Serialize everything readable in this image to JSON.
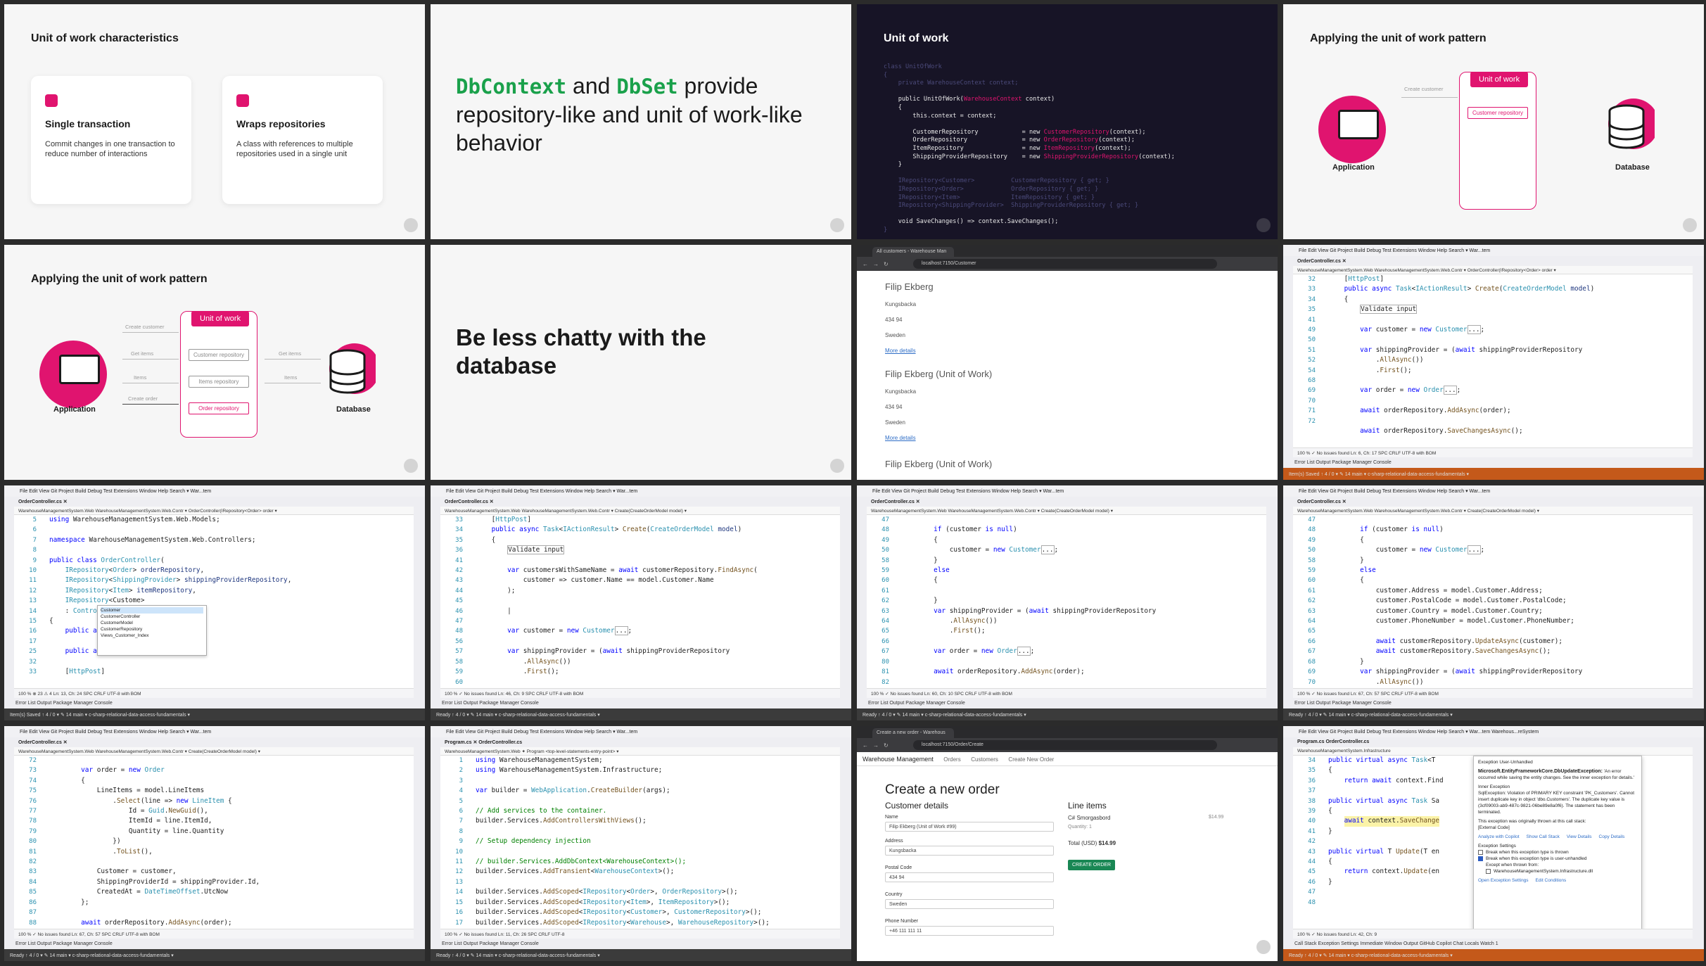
{
  "slides": {
    "characteristics": {
      "title": "Unit of work characteristics",
      "cards": [
        {
          "icon": "database-icon",
          "heading": "Single transaction",
          "text": "Commit changes in one transaction to reduce number of interactions"
        },
        {
          "icon": "layers-icon",
          "heading": "Wraps repositories",
          "text": "A class with references to multiple repositories used in a single unit"
        }
      ]
    },
    "dbcontext": {
      "m1": "DbContext",
      "t1": " and ",
      "m2": "DbSet",
      "t2": " provide repository-like and unit of work-like behavior"
    },
    "unit_of_work_code": {
      "title": "Unit of work",
      "l1": "class UnitOfWork",
      "l2": "{",
      "l3": "    private WarehouseContext context;",
      "l4": "    public UnitOfWork(",
      "l4b": "WarehouseContext",
      "l4c": " context)",
      "l5": "    {",
      "l6": "        this.context = context;",
      "l7a": "        CustomerRepository            = new ",
      "l7b": "CustomerRepository",
      "l7c": "(context);",
      "l8a": "        OrderRepository               = new ",
      "l8b": "OrderRepository",
      "l8c": "(context);",
      "l9a": "        ItemRepository                = new ",
      "l9b": "ItemRepository",
      "l9c": "(context);",
      "l10a": "        ShippingProviderRepository    = new ",
      "l10b": "ShippingProviderRepository",
      "l10c": "(context);",
      "l11": "    }",
      "l12": "    IRepository<Customer>          CustomerRepository { get; }",
      "l13": "    IRepository<Order>             OrderRepository { get; }",
      "l14": "    IRepository<Item>              ItemRepository { get; }",
      "l15": "    IRepository<ShippingProvider>  ShippingProviderRepository { get; }",
      "l16": "    void SaveChanges() => context.SaveChanges();",
      "l17": "}"
    },
    "applying1": {
      "title": "Applying the unit of work pattern",
      "tag": "Unit of work",
      "repo": "Customer repository",
      "arrow": "Create customer",
      "app": "Application",
      "db": "Database"
    },
    "applying2": {
      "title": "Applying the unit of work pattern",
      "tag": "Unit of work",
      "repos": [
        "Customer repository",
        "Items repository",
        "Order repository"
      ],
      "arrows_left": [
        "Create customer",
        "Get items",
        "Items",
        "Create order"
      ],
      "arrows_right": [
        "Get items",
        "Items"
      ],
      "app": "Application",
      "db": "Database"
    },
    "chatty": {
      "title": "Be less chatty with the database"
    }
  },
  "browser1": {
    "tab": "All customers - Warehouse Man",
    "url": "localhost:7150/Customer",
    "customers": [
      {
        "name": "Filip Ekberg",
        "lines": [
          "Kungsbacka",
          "434 94",
          "Sweden"
        ],
        "link": "More details"
      },
      {
        "name": "Filip Ekberg (Unit of Work)",
        "lines": [
          "Kungsbacka",
          "434 94",
          "Sweden"
        ],
        "link": "More details"
      },
      {
        "name": "Filip Ekberg (Unit of Work)"
      }
    ]
  },
  "vs": {
    "menu": "File  Edit  View  Git  Project  Build  Debug  Test  Extensions  Window  Help   Search ▾     War...tem",
    "panes": "Error List   Output   Package Manager Console",
    "s1": {
      "tab": "OrderController.cs  ✕",
      "nav": "WarehouseManagementSystem.Web        WarehouseManagementSystem.Web.Contr ▾     OrderController(IRepository<Order> order ▾",
      "status": "100 %  ✓ No issues found                                  Ln: 6, Ch: 17   SPC   CRLF   UTF-8 with BOM",
      "bar": "Item(s) Saved                                        ↑ 4 / 0 ▾   ✎ 14    main ▾    c-sharp-relational-data-access-fundamentals ▾"
    },
    "s2": {
      "tab": "OrderController.cs  ✕",
      "nav": "WarehouseManagementSystem.Web        WarehouseManagementSystem.Web.Contr ▾     OrderController(IRepository<Order> order ▾",
      "status": "100 %  ⊗ 23  ⚠ 4                                        Ln: 13, Ch: 24   SPC   CRLF   UTF-8 with BOM",
      "bar": "Item(s) Saved                                        ↑ 4 / 0 ▾   ✎ 14    main ▾    c-sharp-relational-data-access-fundamentals ▾"
    },
    "s3": {
      "tab": "OrderController.cs  ✕",
      "nav": "WarehouseManagementSystem.Web        WarehouseManagementSystem.Web.Contr ▾     Create(CreateOrderModel model) ▾",
      "status": "100 %  ✓ No issues found                                  Ln: 46, Ch: 9   SPC   CRLF   UTF-8 with BOM",
      "bar": "Ready                                                ↑ 4 / 0 ▾   ✎ 14    main ▾    c-sharp-relational-data-access-fundamentals ▾"
    },
    "s4": {
      "tab": "OrderController.cs  ✕",
      "nav": "WarehouseManagementSystem.Web        WarehouseManagementSystem.Web.Contr ▾     Create(CreateOrderModel model) ▾",
      "status": "100 %  ✓ No issues found                                  Ln: 60, Ch: 10   SPC   CRLF   UTF-8 with BOM",
      "bar": "Ready                                                ↑ 4 / 0 ▾   ✎ 14    main ▾    c-sharp-relational-data-access-fundamentals ▾"
    },
    "s5": {
      "tab": "OrderController.cs  ✕",
      "nav": "WarehouseManagementSystem.Web        WarehouseManagementSystem.Web.Contr ▾     Create(CreateOrderModel model) ▾",
      "status": "100 %  ✓ No issues found                                  Ln: 67, Ch: 57   SPC   CRLF   UTF-8 with BOM",
      "bar": "Ready                                                ↑ 4 / 0 ▾   ✎ 14    main ▾    c-sharp-relational-data-access-fundamentals ▾"
    },
    "s6": {
      "tab": "OrderController.cs  ✕",
      "nav": "WarehouseManagementSystem.Web        WarehouseManagementSystem.Web.Contr ▾     Create(CreateOrderModel model) ▾",
      "status": "100 %  ✓ No issues found                                  Ln: 67, Ch: 57   SPC   CRLF   UTF-8 with BOM",
      "bar": "Ready                                                ↑ 4 / 0 ▾   ✎ 14    main ▾    c-sharp-relational-data-access-fundamentals ▾"
    },
    "s7": {
      "tab": "Program.cs  ✕     OrderController.cs",
      "nav": "WarehouseManagementSystem.Web        ✦ Program                                 <top-level-statements-entry-point> ▾",
      "status": "100 %  ✓ No issues found                                  Ln: 11, Ch: 26   SPC   CRLF   UTF-8",
      "bar": "Ready                                                ↑ 4 / 0 ▾   ✎ 14    main ▾    c-sharp-relational-data-access-fundamentals ▾"
    },
    "s8": {
      "tab": "Program.cs       OrderController.cs",
      "nav": "WarehouseManagementSystem.Infrastructure",
      "status": "100 %  ✓ No issues found                                  Ln: 42, Ch: 9",
      "bar": "Ready                                                ↑ 4 / 0 ▾   ✎ 14    main ▾    c-sharp-relational-data-access-fundamentals ▾",
      "title": "Warehous...reSystem",
      "panes": "Call Stack   Exception Settings   Immediate Window   Output   GitHub Copilot Chat   Locals   Watch 1"
    }
  },
  "create_order": {
    "tab": "Create a new order - Warehous",
    "url": "localhost:7150/Order/Create",
    "brand": "Warehouse Management",
    "links": [
      "Orders",
      "Customers",
      "Create New Order"
    ],
    "heading": "Create a new order",
    "customer_details": "Customer details",
    "line_items": "Line items",
    "name_label": "Name",
    "name_value": "Filip Ekberg (Unit of Work #99)",
    "address_label": "Address",
    "address_value": "Kungsbacka",
    "postal_label": "Postal Code",
    "postal_value": "434 94",
    "country_label": "Country",
    "country_value": "Sweden",
    "phone_label": "Phone Number",
    "phone_value": "+46 111 111 11",
    "item_name": "C# Smorgasbord",
    "item_price": "$14.99",
    "quantity": "Quantity: 1",
    "total_label": "Total (USD)",
    "total_value": "$14.99",
    "button": "CREATE ORDER"
  },
  "exception": {
    "title": "Exception User-Unhandled",
    "type": "Microsoft.EntityFrameworkCore.DbUpdateException:",
    "msg": "'An error occurred while saving the entity changes. See the inner exception for details.'",
    "inner": "Inner Exception",
    "inner_msg": "SqlException: Violation of PRIMARY KEY constraint 'PK_Customers'. Cannot insert duplicate key in object 'dbo.Customers'. The duplicate key value is (3cf09003-ab9-487c-9821-06be89e8a0f6). The statement has been terminated.",
    "thrown": "This exception was originally thrown at this call stack:",
    "external": "[External Code]",
    "links": [
      "Analyze with Copilot",
      "Show Call Stack",
      "View Details",
      "Copy Details"
    ],
    "settings": "Exception Settings",
    "cb1": "Break when this exception type is thrown",
    "cb2": "Break when this exception type is user-unhandled",
    "except": "Except when thrown from:",
    "cb3": "WarehouseManagementSystem.Infrastructure.dll",
    "foot": [
      "Open Exception Settings",
      "Edit Conditions"
    ]
  },
  "intellisense": [
    "Customer",
    "CustomerController",
    "CustomerModel",
    "CustomerRepository",
    "Views_Customer_Index"
  ]
}
